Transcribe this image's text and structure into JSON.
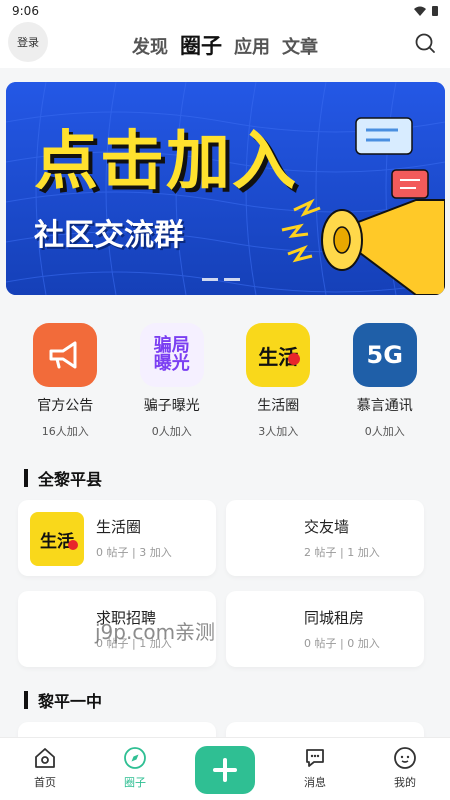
{
  "status": {
    "time": "9:06"
  },
  "header": {
    "login_label": "登录",
    "tabs": [
      {
        "label": "发现"
      },
      {
        "label": "圈子"
      },
      {
        "label": "应用"
      },
      {
        "label": "文章"
      }
    ],
    "active_tab": "圈子"
  },
  "banner": {
    "title": "点击加入",
    "subtitle": "社区交流群",
    "page_count": 2,
    "active_page": 1
  },
  "shortcuts": [
    {
      "name": "官方公告",
      "count": "16人加入",
      "icon": "megaphone-icon",
      "color": "#f26b3a"
    },
    {
      "name": "骗子曝光",
      "count": "0人加入",
      "icon": "fraud-expose-icon",
      "color": "#7b3ff2"
    },
    {
      "name": "生活圈",
      "count": "3人加入",
      "icon": "life-circle-icon",
      "color": "#f9d81b"
    },
    {
      "name": "慕言通讯",
      "count": "0人加入",
      "icon": "5g-icon",
      "color": "#1f5fa8"
    }
  ],
  "icon_text": {
    "fraud_1": "骗局",
    "fraud_2": "曝光",
    "life": "生活",
    "fiveg": "5G"
  },
  "sections": [
    {
      "title": "全黎平县",
      "cards": [
        {
          "name": "生活圈",
          "meta": "0 帖子 | 3 加入",
          "has_thumb": true
        },
        {
          "name": "交友墙",
          "meta": "2 帖子 | 1 加入",
          "has_thumb": false
        },
        {
          "name": "求职招聘",
          "meta": "0 帖子 | 1 加入",
          "has_thumb": false
        },
        {
          "name": "同城租房",
          "meta": "0 帖子 | 0 加入",
          "has_thumb": false
        }
      ]
    },
    {
      "title": "黎平一中",
      "cards": []
    }
  ],
  "watermark": "j9p.com亲测",
  "tabbar": {
    "items": [
      {
        "label": "首页",
        "icon": "home-icon"
      },
      {
        "label": "圈子",
        "icon": "compass-icon"
      },
      {
        "label": "",
        "icon": "plus-icon"
      },
      {
        "label": "消息",
        "icon": "message-icon"
      },
      {
        "label": "我的",
        "icon": "profile-icon"
      }
    ]
  },
  "colors": {
    "accent": "#2fbf93",
    "banner_bg": "#1d4fd8",
    "banner_text": "#ffe12e"
  }
}
